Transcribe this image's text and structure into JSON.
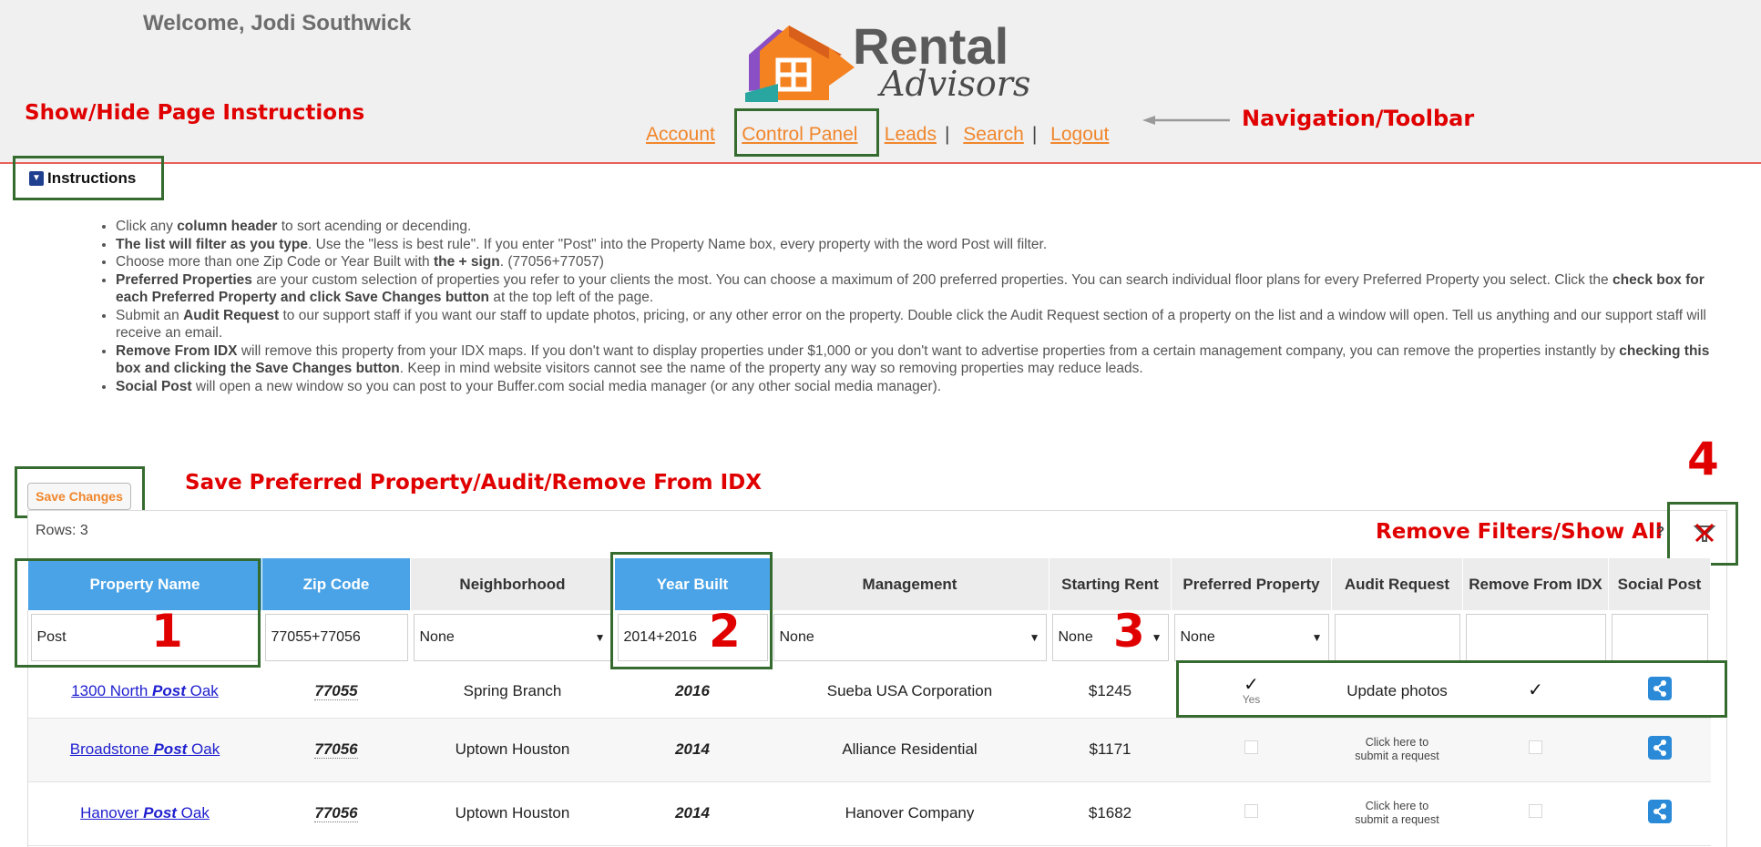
{
  "header": {
    "welcome": "Welcome, Jodi Southwick",
    "logo_line1": "Rental",
    "logo_line2": "Advisors"
  },
  "nav": {
    "account": "Account",
    "control_panel": "Control Panel",
    "leads": "Leads",
    "search": "Search",
    "logout": "Logout",
    "separator": "|"
  },
  "annotations": {
    "show_hide": "Show/Hide Page Instructions",
    "navigation": "Navigation/Toolbar",
    "save": "Save Preferred Property/Audit/Remove From IDX",
    "remove_filters": "Remove Filters/Show All",
    "num1": "1",
    "num2": "2",
    "num3": "3",
    "num4": "4",
    "color": "#e00000",
    "box_color": "#356b2e"
  },
  "instructions": {
    "toggle_label": "Instructions",
    "items": [
      {
        "parts": [
          [
            "",
            "Click any "
          ],
          [
            "b",
            "column header"
          ],
          [
            "",
            " to sort acending or decending."
          ]
        ]
      },
      {
        "parts": [
          [
            "b",
            "The list will filter as you type"
          ],
          [
            "",
            ". Use the \"less is best rule\". If you enter \"Post\" into the Property Name box, every property with the word Post will filter."
          ]
        ]
      },
      {
        "parts": [
          [
            "",
            "Choose more than one Zip Code or Year Built with "
          ],
          [
            "b",
            "the + sign"
          ],
          [
            "",
            ". (77056+77057)"
          ]
        ]
      },
      {
        "parts": [
          [
            "b",
            "Preferred Properties"
          ],
          [
            "",
            " are your custom selection of properties you refer to your clients the most. You can choose a maximum of 200 preferred properties. You can search individual floor plans for every Preferred Property you select. Click the "
          ],
          [
            "b",
            "check box for each Preferred Property and click Save Changes button"
          ],
          [
            "",
            " at the top left of the page."
          ]
        ]
      },
      {
        "parts": [
          [
            "",
            "Submit an "
          ],
          [
            "b",
            "Audit Request"
          ],
          [
            "",
            " to our support staff if you want our staff to update photos, pricing, or any other error on the property. Double click the Audit Request section of a property on the list and a window will open. Tell us anything and our support staff will receive an email."
          ]
        ]
      },
      {
        "parts": [
          [
            "b",
            "Remove From IDX"
          ],
          [
            "",
            " will remove this property from your IDX maps. If you don't want to display properties under $1,000 or you don't want to advertise properties from a certain management company, you can remove the properties instantly by "
          ],
          [
            "b",
            "checking this box and clicking the Save Changes button"
          ],
          [
            "",
            ". Keep in mind website visitors cannot see the name of the property any way so removing properties may reduce leads."
          ]
        ]
      },
      {
        "parts": [
          [
            "b",
            "Social Post"
          ],
          [
            "",
            " will open a new window so you can post to your Buffer.com social media manager (or any other social media manager)."
          ]
        ]
      }
    ]
  },
  "toolbar": {
    "save_label": "Save Changes",
    "rows_label": "Rows: 3",
    "help": "?"
  },
  "table": {
    "headers": [
      "Property Name",
      "Zip Code",
      "Neighborhood",
      "Year Built",
      "Management",
      "Starting Rent",
      "Preferred Property",
      "Audit Request",
      "Remove From IDX",
      "Social Post"
    ],
    "sorted_header_color": "#4aa3e6",
    "filters": {
      "property_name": "Post",
      "zip_code": "77055+77056",
      "neighborhood": "None",
      "year_built": "2014+2016",
      "management": "None",
      "starting_rent": "None",
      "preferred_property": "None",
      "audit_request": "",
      "remove_from_idx": "",
      "social_post": ""
    },
    "rows": [
      {
        "name_pre": "1300 North ",
        "name_em": "Post",
        "name_post": " Oak",
        "zip": "77055",
        "neighborhood": "Spring Branch",
        "year": "2016",
        "management": "Sueba USA Corporation",
        "rent": "$1245",
        "preferred_check": "✓",
        "preferred_text": "Yes",
        "audit": "Update photos",
        "remove_check": "✓"
      },
      {
        "name_pre": "Broadstone ",
        "name_em": "Post",
        "name_post": " Oak",
        "zip": "77056",
        "neighborhood": "Uptown Houston",
        "year": "2014",
        "management": "Alliance Residential",
        "rent": "$1171",
        "audit_line1": "Click here to",
        "audit_line2": "submit a request"
      },
      {
        "name_pre": "Hanover ",
        "name_em": "Post",
        "name_post": " Oak",
        "zip": "77056",
        "neighborhood": "Uptown Houston",
        "year": "2014",
        "management": "Hanover Company",
        "rent": "$1682",
        "audit_line1": "Click here to",
        "audit_line2": "submit a request"
      }
    ]
  }
}
